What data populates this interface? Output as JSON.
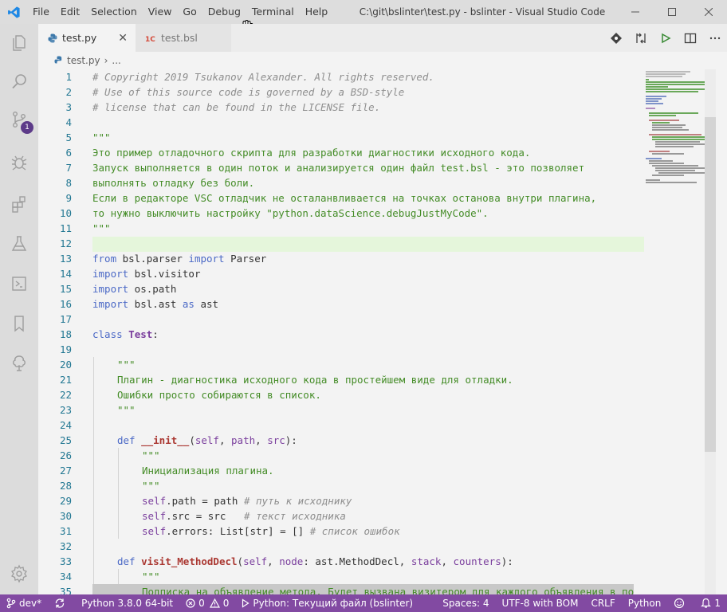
{
  "titlebar": {
    "menu": [
      "File",
      "Edit",
      "Selection",
      "View",
      "Go",
      "Debug",
      "Terminal",
      "Help"
    ],
    "window_title": "C:\\git\\bslinter\\test.py - bslinter - Visual Studio Code"
  },
  "activitybar": {
    "items": [
      "explorer-icon",
      "search-icon",
      "source-control-icon",
      "debug-icon",
      "extensions-icon",
      "testing-icon",
      "terminal-icon",
      "bookmarks-icon",
      "tree-icon"
    ],
    "source_control_badge": "1",
    "bottom": "settings-gear-icon"
  },
  "tabs": [
    {
      "label": "test.py",
      "active": true,
      "close": "✕"
    },
    {
      "label": "test.bsl",
      "active": false
    }
  ],
  "breadcrumb": {
    "file": "test.py",
    "more": "..."
  },
  "editor": {
    "line_numbers": [
      "1",
      "2",
      "3",
      "4",
      "5",
      "6",
      "7",
      "8",
      "9",
      "10",
      "11",
      "12",
      "13",
      "14",
      "15",
      "16",
      "17",
      "18",
      "19",
      "20",
      "21",
      "22",
      "23",
      "24",
      "25",
      "26",
      "27",
      "28",
      "29",
      "30",
      "31",
      "32",
      "33",
      "34",
      "35"
    ],
    "lines": {
      "l1": "# Copyright 2019 Tsukanov Alexander. All rights reserved.",
      "l2": "# Use of this source code is governed by a BSD-style",
      "l3": "# license that can be found in the LICENSE file.",
      "l5": "\"\"\"",
      "l6": "Это пример отладочного скрипта для разработки диагностики исходного кода.",
      "l7": "Запуск выполняется в один поток и анализируется один файл test.bsl - это позволяет",
      "l8": "выполнять отладку без боли.",
      "l9": "Если в редакторе VSC отладчик не осталанвливается на точках останова внутри плагина,",
      "l10": "то нужно выключить настройку \"python.dataScience.debugJustMyCode\".",
      "l11": "\"\"\"",
      "l13_kw1": "from",
      "l13_mod": " bsl.parser ",
      "l13_kw2": "import",
      "l13_name": " Parser",
      "l14_kw": "import",
      "l14_mod": " bsl.visitor",
      "l15_kw": "import",
      "l15_mod": " os.path",
      "l16_kw": "import",
      "l16_mod": " bsl.ast ",
      "l16_kw2": "as",
      "l16_name": " ast",
      "l18_kw": "class",
      "l18_name": "Test",
      "l18_colon": ":",
      "l20": "\"\"\"",
      "l21": "Плагин - диагностика исходного кода в простейшем виде для отладки.",
      "l22": "Ошибки просто собираются в список.",
      "l23": "\"\"\"",
      "l25_kw": "def",
      "l25_fn": "__init__",
      "l25_open": "(",
      "l25_p1": "self",
      "l25_c1": ", ",
      "l25_p2": "path",
      "l25_c2": ", ",
      "l25_p3": "src",
      "l25_close": "):",
      "l26": "\"\"\"",
      "l27": "Инициализация плагина.",
      "l28": "\"\"\"",
      "l29_self": "self",
      "l29_code": ".path = path ",
      "l29_com": "# путь к исходнику",
      "l30_self": "self",
      "l30_code": ".src = src   ",
      "l30_com": "# текст исходника",
      "l31_self": "self",
      "l31_code": ".errors: List[str] = [] ",
      "l31_com": "# список ошибок",
      "l33_kw": "def",
      "l33_fn": "visit_MethodDecl",
      "l33_open": "(",
      "l33_p1": "self",
      "l33_c1": ", ",
      "l33_p2": "node",
      "l33_t2": ": ast.MethodDecl, ",
      "l33_p3": "stack",
      "l33_c3": ", ",
      "l33_p4": "counters",
      "l33_close": "):",
      "l34": "\"\"\"",
      "l35": "Подписка на объявление метода. Будет вызвана визитером для каждого объявления в по"
    }
  },
  "statusbar": {
    "branch": "dev*",
    "python": "Python 3.8.0 64-bit",
    "errors": "0",
    "warnings": "0",
    "debug_target": "Python: Текущий файл (bslinter)",
    "spaces": "Spaces: 4",
    "encoding": "UTF-8 with BOM",
    "eol": "CRLF",
    "language": "Python",
    "notifications": "1"
  },
  "colors": {
    "statusbar": "#824aa2",
    "comment": "#8e8e8e",
    "string": "#448c27",
    "keyword": "#4b69c6",
    "line_numbers": "#237893"
  }
}
